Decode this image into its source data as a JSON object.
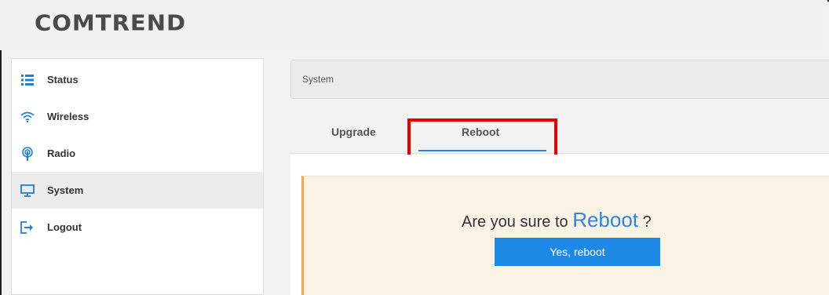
{
  "header": {
    "logo_text": "COMTREND"
  },
  "sidebar": {
    "items": [
      {
        "label": "Status",
        "icon": "list-icon"
      },
      {
        "label": "Wireless",
        "icon": "wifi-icon"
      },
      {
        "label": "Radio",
        "icon": "antenna-icon"
      },
      {
        "label": "System",
        "icon": "monitor-icon",
        "active": true
      },
      {
        "label": "Logout",
        "icon": "logout-icon"
      }
    ]
  },
  "breadcrumb": {
    "text": "System"
  },
  "tabs": [
    {
      "label": "Upgrade"
    },
    {
      "label": "Reboot",
      "active": true
    }
  ],
  "dialog": {
    "question_prefix": "Are you sure to",
    "question_accent": "Reboot",
    "question_suffix": "?",
    "confirm_label": "Yes, reboot"
  },
  "colors": {
    "accent": "#2a86de",
    "button": "#1e88e5",
    "highlight": "#e60000",
    "card_border": "#f0a64a"
  }
}
